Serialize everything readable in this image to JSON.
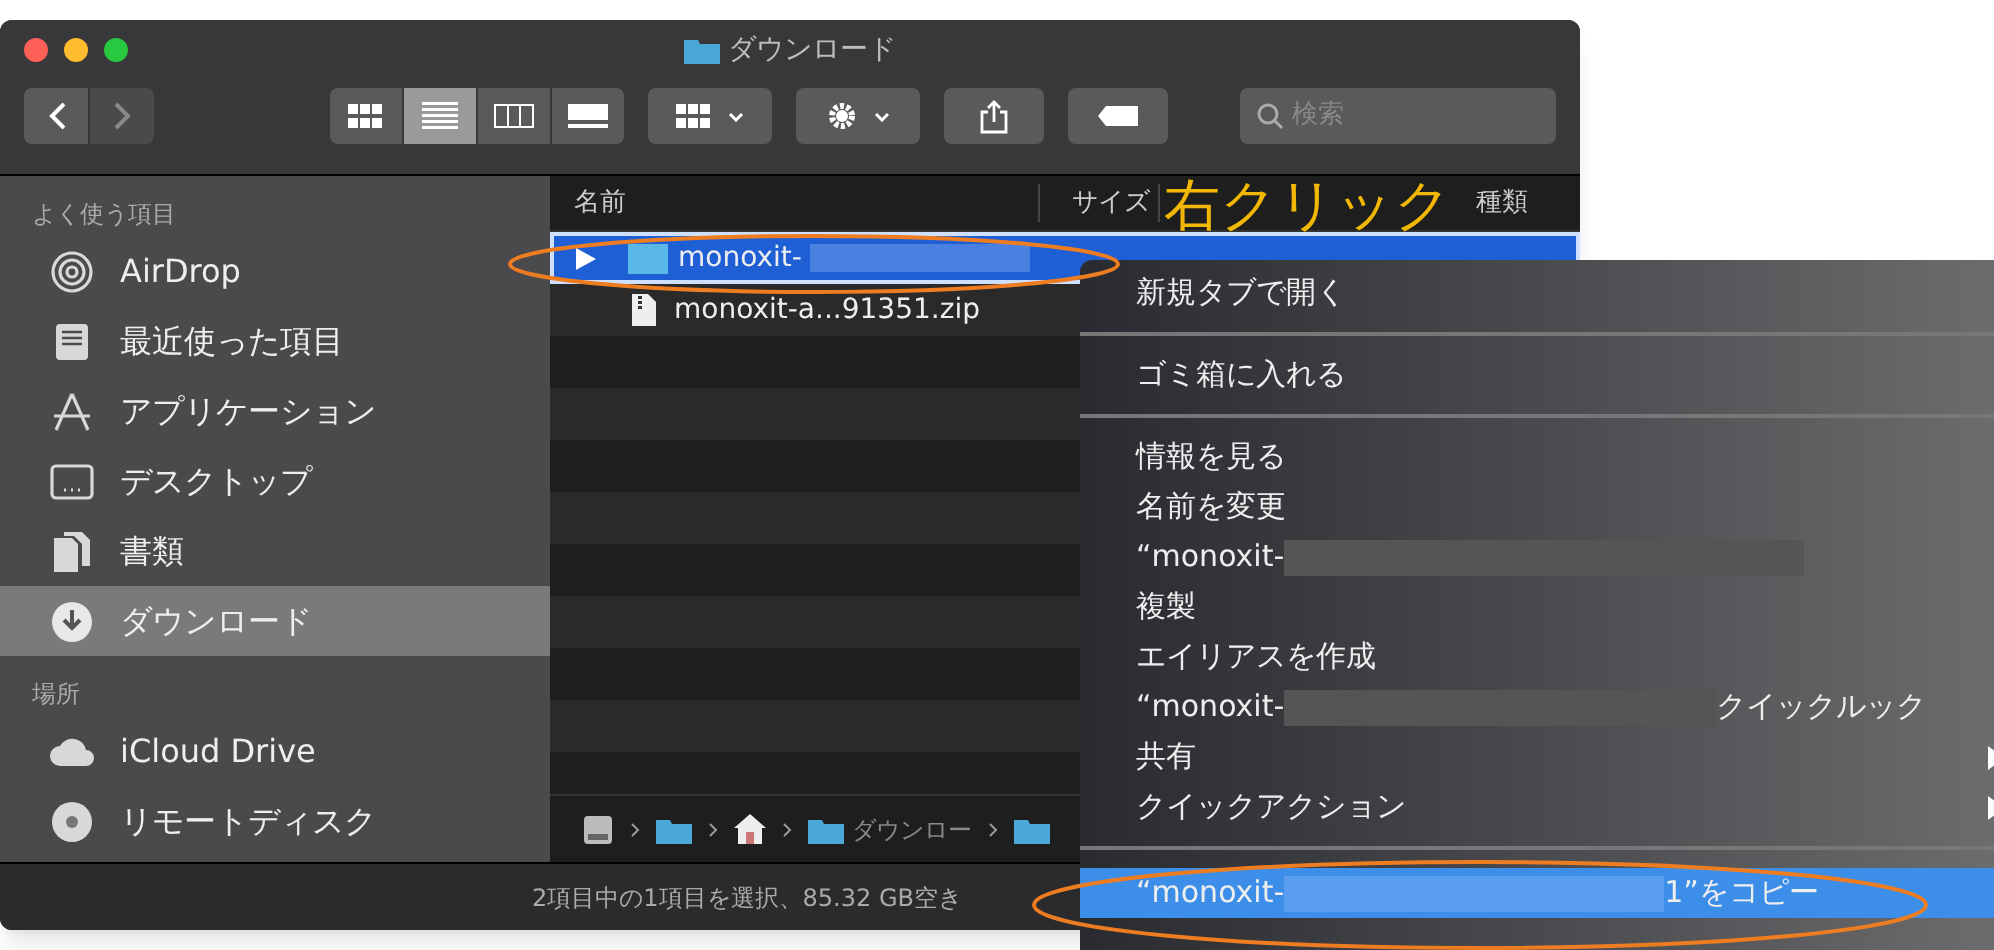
{
  "window": {
    "title": "ダウンロード"
  },
  "toolbar": {
    "view_modes": [
      {
        "kind": "icons",
        "selected": false
      },
      {
        "kind": "list",
        "selected": true
      },
      {
        "kind": "columns",
        "selected": false
      },
      {
        "kind": "gallery",
        "selected": false
      }
    ],
    "search": {
      "placeholder": "検索"
    }
  },
  "sidebar": {
    "sections": [
      {
        "title": "よく使う項目",
        "items": [
          {
            "label": "AirDrop",
            "selected": false
          },
          {
            "label": "最近使った項目",
            "selected": false
          },
          {
            "label": "アプリケーション",
            "selected": false
          },
          {
            "label": "デスクトップ",
            "selected": false
          },
          {
            "label": "書類",
            "selected": false
          },
          {
            "label": "ダウンロード",
            "selected": true
          }
        ]
      },
      {
        "title": "場所",
        "items": [
          {
            "label": "iCloud Drive",
            "selected": false
          },
          {
            "label": "リモートディスク",
            "selected": false
          }
        ]
      }
    ]
  },
  "file_list": {
    "columns": [
      "名前",
      "サイズ",
      "種類"
    ],
    "rows": [
      {
        "name": "monoxit-",
        "kind": "folder",
        "redacted": true,
        "selected": true
      },
      {
        "name": "monoxit-a...91351.zip",
        "kind": "zip",
        "redacted": false,
        "selected": false
      }
    ]
  },
  "path_bar": {
    "items": [
      {
        "kind": "disk"
      },
      {
        "kind": "folder"
      },
      {
        "kind": "home"
      },
      {
        "kind": "folder",
        "label": "ダウンロー"
      },
      {
        "kind": "folder"
      }
    ]
  },
  "status_bar": "2項目中の1項目を選択、85.32 GB空き",
  "context_menu": [
    {
      "kind": "item",
      "label": "新規タブで開く",
      "selected": false
    },
    {
      "kind": "separator"
    },
    {
      "kind": "item",
      "label": "ゴミ箱に入れる",
      "selected": false
    },
    {
      "kind": "separator"
    },
    {
      "kind": "item",
      "label": "情報を見る",
      "selected": false
    },
    {
      "kind": "item",
      "label": "名前を変更",
      "selected": false
    },
    {
      "kind": "redacted",
      "prefix": "“monoxit-",
      "selected": false
    },
    {
      "kind": "item",
      "label": "複製",
      "selected": false
    },
    {
      "kind": "item",
      "label": "エイリアスを作成",
      "selected": false
    },
    {
      "kind": "redacted",
      "prefix": "“monoxit-",
      "suffix": "クイックルック",
      "selected": false
    },
    {
      "kind": "submenu",
      "label": "共有",
      "selected": false
    },
    {
      "kind": "submenu",
      "label": "クイックアクション",
      "selected": false
    },
    {
      "kind": "separator"
    },
    {
      "kind": "redacted",
      "prefix": "“monoxit-",
      "suffix": "1”をコピー",
      "selected": true
    }
  ],
  "annotation": {
    "label": "右クリック"
  }
}
